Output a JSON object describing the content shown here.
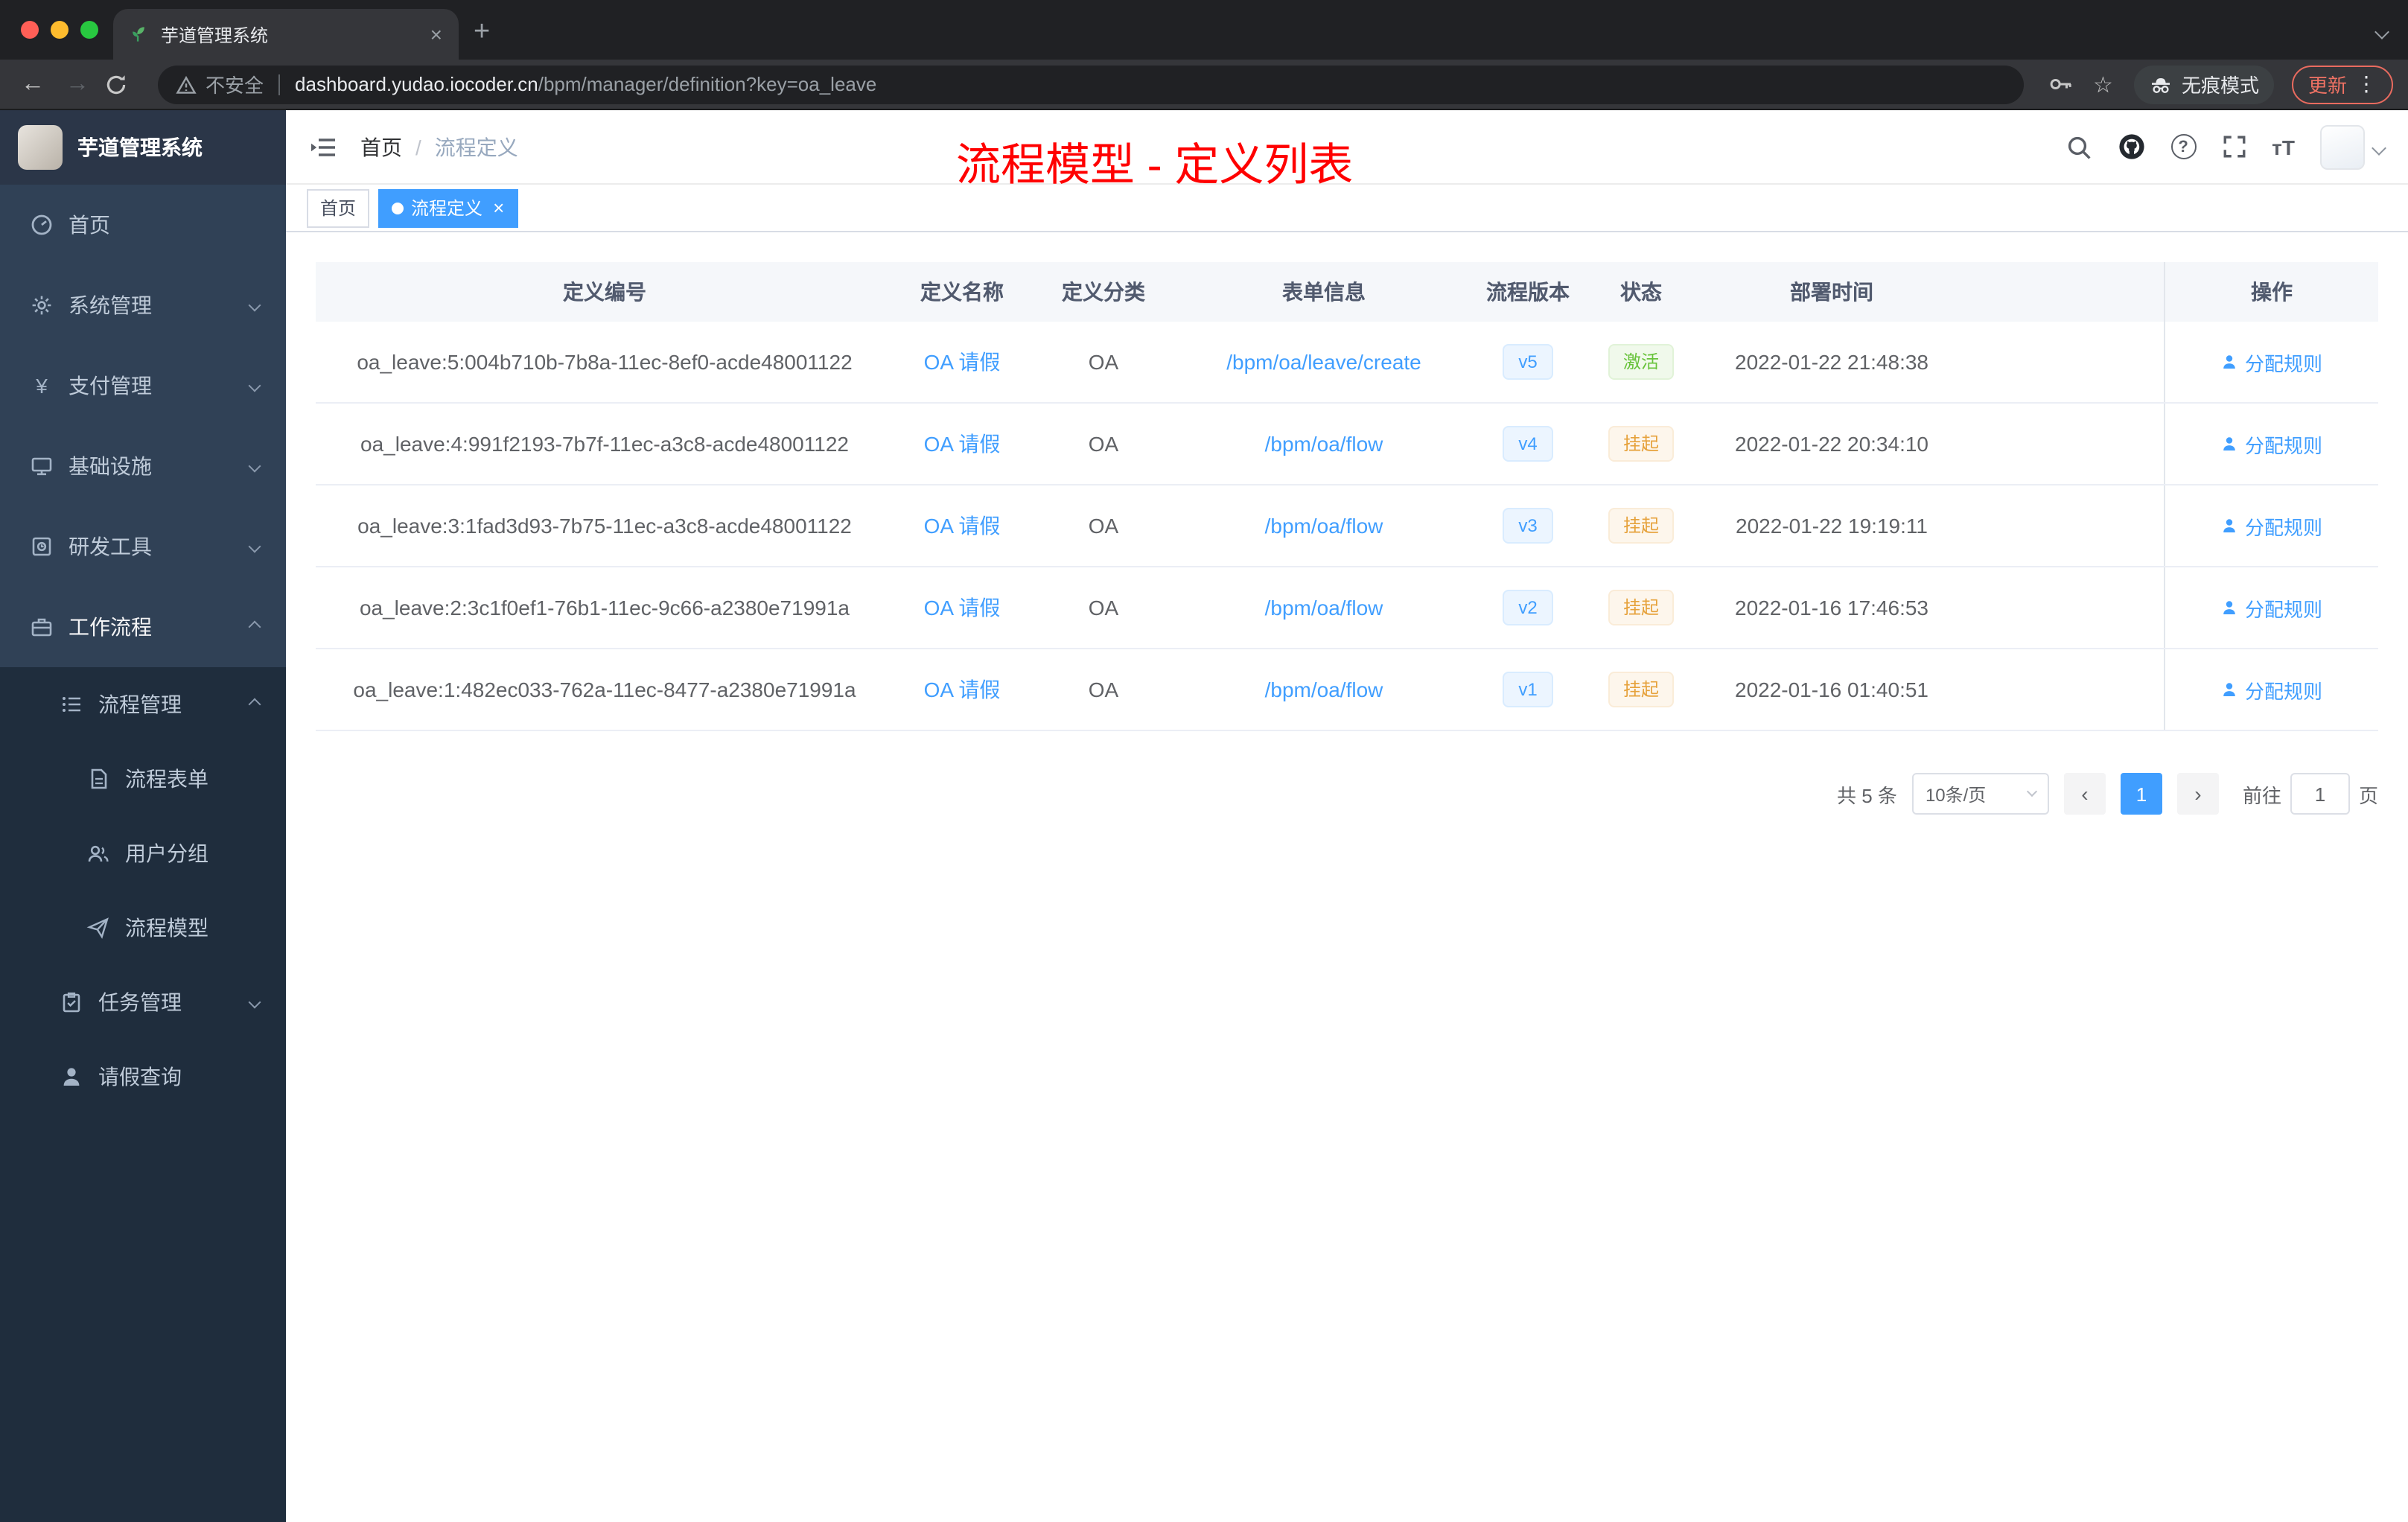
{
  "browser": {
    "tab_title": "芋道管理系统",
    "close_glyph": "×",
    "plus_glyph": "+",
    "back_glyph": "←",
    "forward_glyph": "→",
    "security_label": "不安全",
    "url_host": "dashboard.yudao.iocoder.cn",
    "url_path": "/bpm/manager/definition?key=oa_leave",
    "star_glyph": "☆",
    "incognito_label": "无痕模式",
    "update_label": "更新",
    "dots_glyph": "⋮"
  },
  "sidebar": {
    "logo_title": "芋道管理系统",
    "items": [
      {
        "label": "首页"
      },
      {
        "label": "系统管理"
      },
      {
        "label": "支付管理"
      },
      {
        "label": "基础设施"
      },
      {
        "label": "研发工具"
      },
      {
        "label": "工作流程"
      },
      {
        "label": "流程管理"
      },
      {
        "label": "流程表单"
      },
      {
        "label": "用户分组"
      },
      {
        "label": "流程模型"
      },
      {
        "label": "任务管理"
      },
      {
        "label": "请假查询"
      }
    ],
    "yen_glyph": "¥"
  },
  "navbar": {
    "breadcrumb_home": "首页",
    "breadcrumb_sep": "/",
    "breadcrumb_current": "流程定义",
    "question_glyph": "?",
    "size_glyph": "тT",
    "annotation": "流程模型 - 定义列表"
  },
  "tags": [
    {
      "label": "首页"
    },
    {
      "label": "流程定义",
      "close_glyph": "×"
    }
  ],
  "table": {
    "columns": [
      "定义编号",
      "定义名称",
      "定义分类",
      "表单信息",
      "流程版本",
      "状态",
      "部署时间",
      "操作"
    ],
    "rows": [
      {
        "id": "oa_leave:5:004b710b-7b8a-11ec-8ef0-acde48001122",
        "name": "OA 请假",
        "category": "OA",
        "form": "/bpm/oa/leave/create",
        "version": "v5",
        "status": "激活",
        "time": "2022-01-22 21:48:38",
        "action": "分配规则"
      },
      {
        "id": "oa_leave:4:991f2193-7b7f-11ec-a3c8-acde48001122",
        "name": "OA 请假",
        "category": "OA",
        "form": "/bpm/oa/flow",
        "version": "v4",
        "status": "挂起",
        "time": "2022-01-22 20:34:10",
        "action": "分配规则"
      },
      {
        "id": "oa_leave:3:1fad3d93-7b75-11ec-a3c8-acde48001122",
        "name": "OA 请假",
        "category": "OA",
        "form": "/bpm/oa/flow",
        "version": "v3",
        "status": "挂起",
        "time": "2022-01-22 19:19:11",
        "action": "分配规则"
      },
      {
        "id": "oa_leave:2:3c1f0ef1-76b1-11ec-9c66-a2380e71991a",
        "name": "OA 请假",
        "category": "OA",
        "form": "/bpm/oa/flow",
        "version": "v2",
        "status": "挂起",
        "time": "2022-01-16 17:46:53",
        "action": "分配规则"
      },
      {
        "id": "oa_leave:1:482ec033-762a-11ec-8477-a2380e71991a",
        "name": "OA 请假",
        "category": "OA",
        "form": "/bpm/oa/flow",
        "version": "v1",
        "status": "挂起",
        "time": "2022-01-16 01:40:51",
        "action": "分配规则"
      }
    ]
  },
  "pagination": {
    "total": "共 5 条",
    "page_size": "10条/页",
    "prev_glyph": "‹",
    "current": "1",
    "next_glyph": "›",
    "goto_prefix": "前往",
    "goto_value": "1",
    "goto_suffix": "页"
  },
  "colors": {
    "accent": "#409eff",
    "success": "#67c23a",
    "warning": "#e6a23c",
    "annotation_red": "#ff0000",
    "sidebar_bg": "#304156",
    "submenu_bg": "#1f2d3d"
  }
}
